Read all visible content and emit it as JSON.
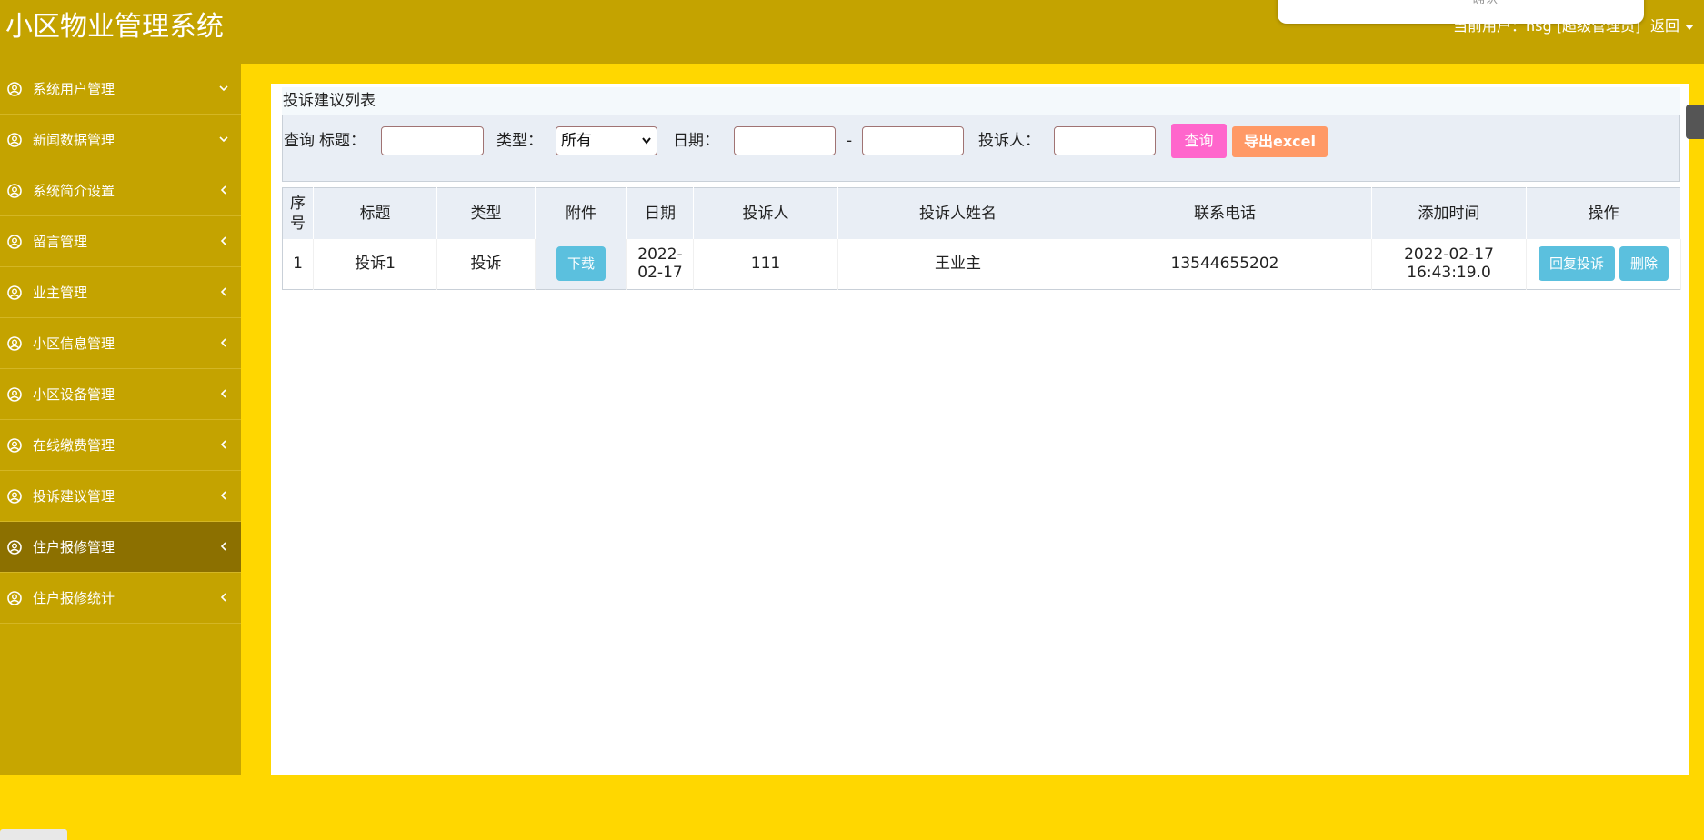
{
  "app": {
    "title": "小区物业管理系统",
    "user_info": "当前用户：hsg [超级管理员]",
    "back_label": "返回",
    "popup_text": "确认"
  },
  "sidebar": {
    "items": [
      {
        "label": "系统用户管理",
        "expanded": true
      },
      {
        "label": "新闻数据管理",
        "expanded": true
      },
      {
        "label": "系统简介设置",
        "expanded": false
      },
      {
        "label": "留言管理",
        "expanded": false
      },
      {
        "label": "业主管理",
        "expanded": false
      },
      {
        "label": "小区信息管理",
        "expanded": false
      },
      {
        "label": "小区设备管理",
        "expanded": false
      },
      {
        "label": "在线缴费管理",
        "expanded": false
      },
      {
        "label": "投诉建议管理",
        "expanded": false
      },
      {
        "label": "住户报修管理",
        "expanded": false,
        "active": true
      },
      {
        "label": "住户报修统计",
        "expanded": false
      }
    ]
  },
  "panel": {
    "title": "投诉建议列表"
  },
  "search": {
    "query_prefix": "查询",
    "title_label": "标题：",
    "title_value": "",
    "type_label": "类型：",
    "type_selected": "所有",
    "date_label": "日期：",
    "date_from": "",
    "date_sep": "-",
    "date_to": "",
    "complainant_label": "投诉人：",
    "complainant_value": "",
    "query_button": "查询",
    "export_button": "导出excel"
  },
  "table": {
    "headers": [
      "序号",
      "标题",
      "类型",
      "附件",
      "日期",
      "投诉人",
      "投诉人姓名",
      "联系电话",
      "添加时间",
      "操作"
    ],
    "rows": [
      {
        "index": "1",
        "title": "投诉1",
        "type": "投诉",
        "attachment_button": "下载",
        "date": "2022-02-17",
        "complainant": "111",
        "complainant_name": "王业主",
        "phone": "13544655202",
        "added_time": "2022-02-17 16:43:19.0",
        "reply_button": "回复投诉",
        "delete_button": "删除"
      }
    ]
  },
  "colors": {
    "header_bg": "#c4a300",
    "sidebar_active": "#8c7000",
    "outer_bg": "#ffd700",
    "query_btn": "#ff66cc",
    "export_btn": "#ff9966",
    "info_btn": "#5bc0de"
  }
}
